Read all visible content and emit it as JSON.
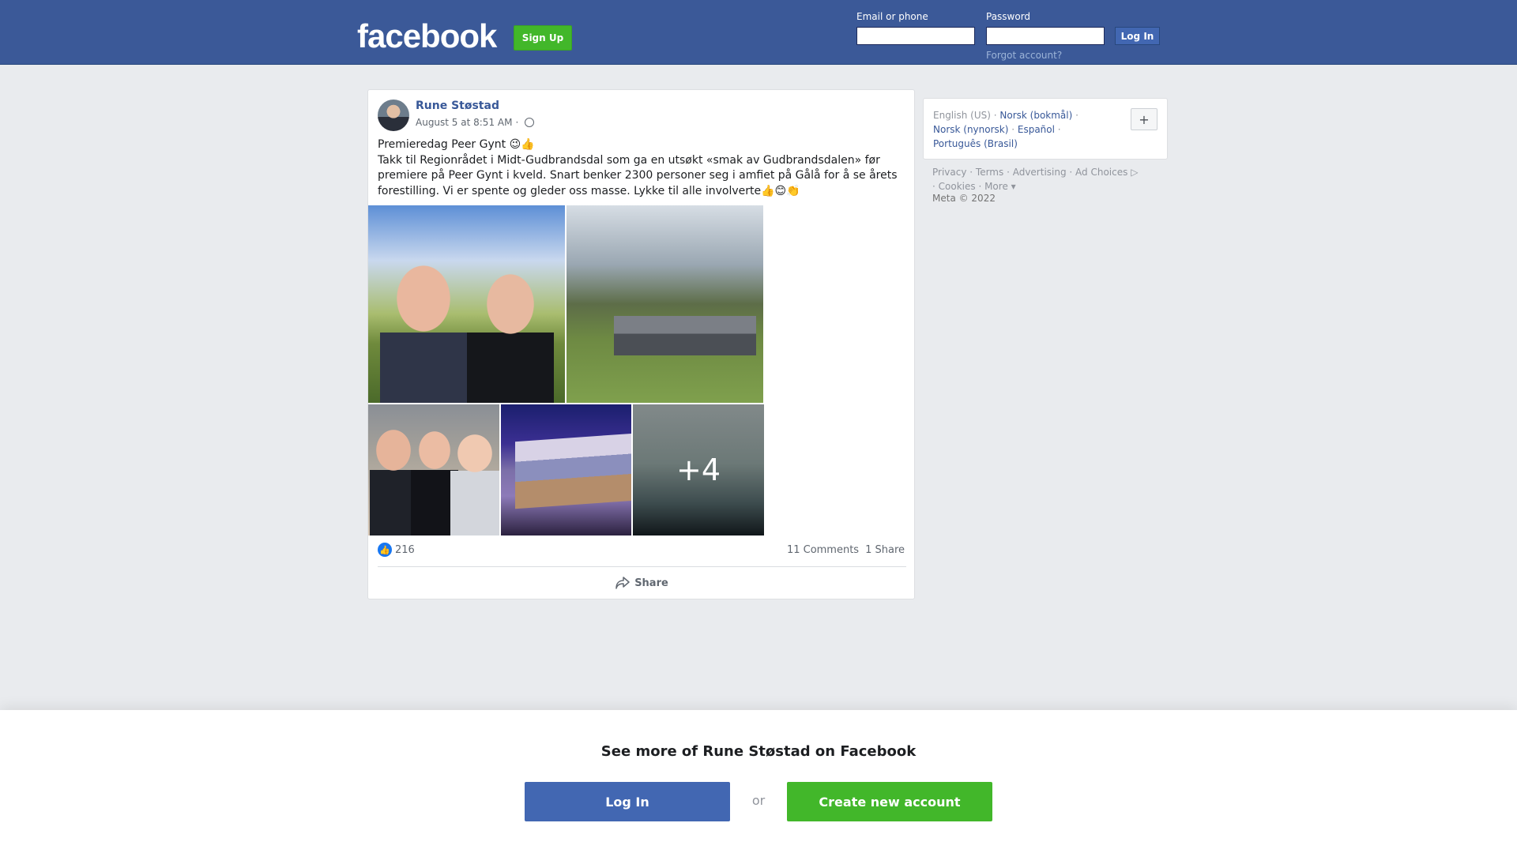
{
  "header": {
    "logo": "facebook",
    "signup_label": "Sign Up",
    "email_label": "Email or phone",
    "password_label": "Password",
    "login_label": "Log In",
    "forgot_label": "Forgot account?"
  },
  "post": {
    "author": "Rune Støstad",
    "date": "August 5 at 8:51 AM",
    "meta_separator": "·",
    "text_line1": "Premieredag Peer Gynt 😉👍",
    "text_body": "Takk til Regionrådet i Midt-Gudbrandsdal som ga en utsøkt «smak av Gudbrandsdalen» før premiere på Peer Gynt i kveld. Snart benker 2300 personer seg i amfiet på Gålå for å se årets forestilling. Vi er spente og gleder oss masse. Lykke til alle involverte👍😊👏",
    "more_photos": "+4",
    "likes": "216",
    "comments": "11 Comments",
    "shares": "1 Share",
    "share_label": "Share"
  },
  "sidebar": {
    "languages": [
      "English (US)",
      "Norsk (bokmål)",
      "Norsk (nynorsk)",
      "Español",
      "Português (Brasil)"
    ],
    "plus_label": "+",
    "footer_links": [
      "Privacy",
      "Terms",
      "Advertising",
      "Ad Choices",
      "Cookies",
      "More"
    ],
    "copyright": "Meta © 2022"
  },
  "banner": {
    "title": "See more of Rune Støstad on Facebook",
    "login_label": "Log In",
    "or_label": "or",
    "create_label": "Create new account"
  },
  "colors": {
    "brand_blue": "#3b5998",
    "button_blue": "#4267b2",
    "green": "#42b72a",
    "link_blue": "#385898"
  }
}
